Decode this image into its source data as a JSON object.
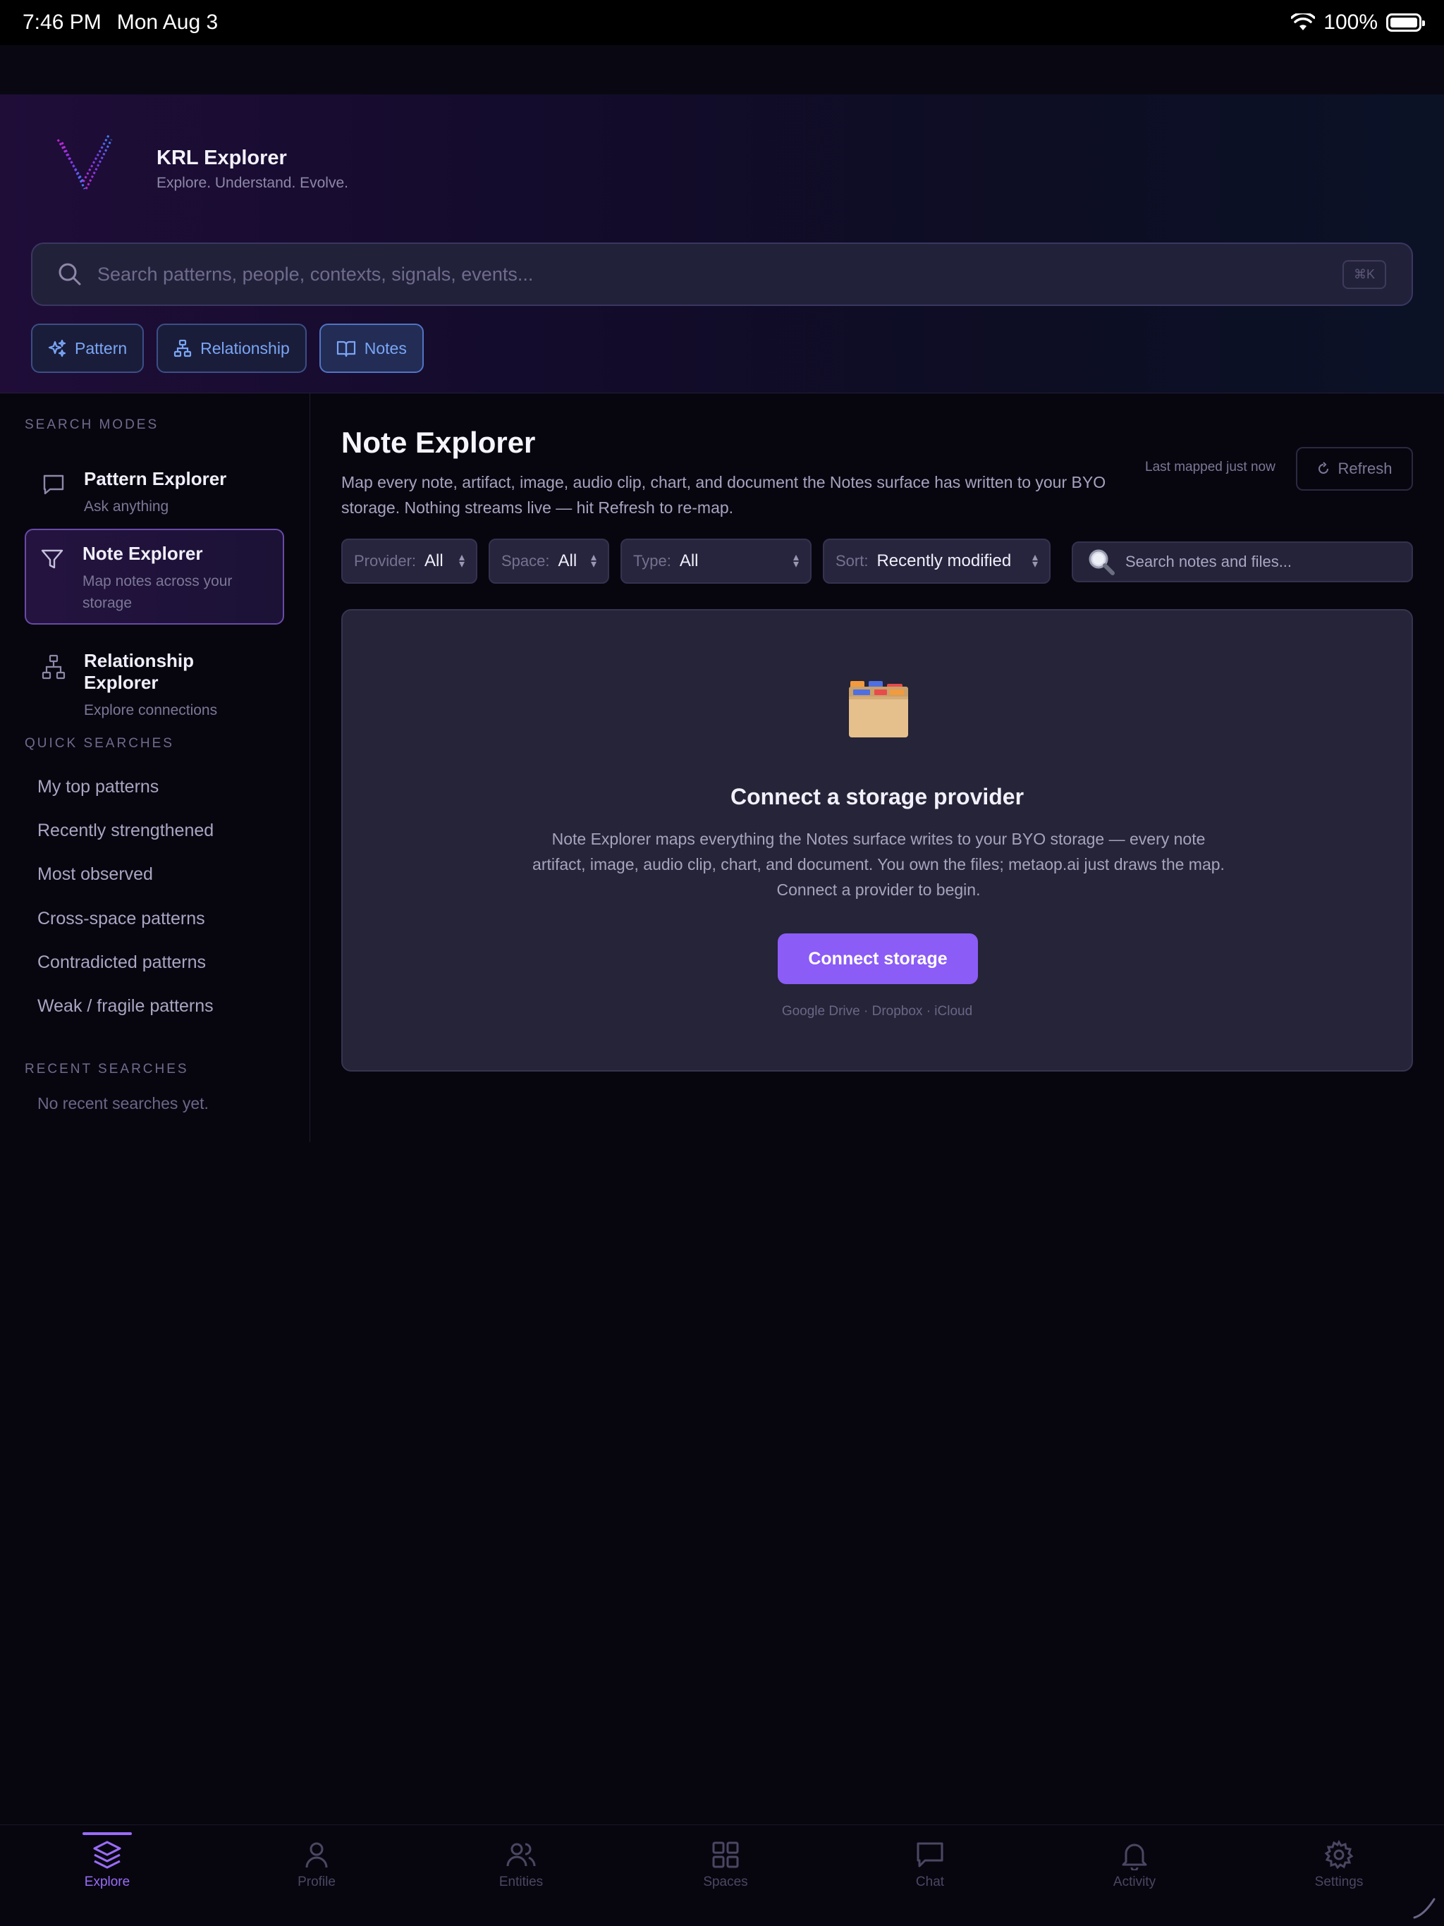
{
  "status_bar": {
    "time": "7:46 PM",
    "date": "Mon Aug 3",
    "battery": "100%"
  },
  "header": {
    "app_title": "KRL Explorer",
    "tagline": "Explore. Understand. Evolve.",
    "search_placeholder": "Search patterns, people, contexts, signals, events...",
    "shortcut": "⌘K",
    "chips": [
      {
        "label": "Pattern",
        "icon": "sparkles-icon"
      },
      {
        "label": "Relationship",
        "icon": "hierarchy-icon"
      },
      {
        "label": "Notes",
        "icon": "book-icon",
        "active": true
      }
    ]
  },
  "sidebar": {
    "search_modes_title": "SEARCH MODES",
    "modes": [
      {
        "title": "Pattern Explorer",
        "subtitle": "Ask anything",
        "icon": "chat-icon"
      },
      {
        "title": "Note Explorer",
        "subtitle": "Map notes across your storage",
        "icon": "filter-icon",
        "active": true
      },
      {
        "title": "Relationship Explorer",
        "subtitle": "Explore connections",
        "icon": "hierarchy-icon"
      }
    ],
    "quick_searches_title": "QUICK SEARCHES",
    "quick_searches": [
      "My top patterns",
      "Recently strengthened",
      "Most observed",
      "Cross-space patterns",
      "Contradicted patterns",
      "Weak / fragile patterns"
    ],
    "recent_searches_title": "RECENT SEARCHES",
    "recent_empty": "No recent searches yet."
  },
  "main": {
    "title": "Note Explorer",
    "description": "Map every note, artifact, image, audio clip, chart, and document the Notes surface has written to your BYO storage. Nothing streams live — hit Refresh to re-map.",
    "last_mapped": "Last mapped just now",
    "refresh_label": "Refresh",
    "filters": {
      "provider": {
        "label": "Provider:",
        "value": "All"
      },
      "space": {
        "label": "Space:",
        "value": "All"
      },
      "type": {
        "label": "Type:",
        "value": "All"
      },
      "sort": {
        "label": "Sort:",
        "value": "Recently modified"
      }
    },
    "notes_search_placeholder": "Search notes and files...",
    "empty_state": {
      "icon": "card-file-box-icon",
      "title": "Connect a storage provider",
      "description": "Note Explorer maps everything the Notes surface writes to your BYO storage — every note artifact, image, audio clip, chart, and document. You own the files; metaop.ai just draws the map. Connect a provider to begin.",
      "button": "Connect storage",
      "providers": "Google Drive · Dropbox · iCloud"
    }
  },
  "tabbar": {
    "tabs": [
      {
        "label": "Explore",
        "icon": "layers-icon",
        "active": true
      },
      {
        "label": "Profile",
        "icon": "user-icon"
      },
      {
        "label": "Entities",
        "icon": "users-icon"
      },
      {
        "label": "Spaces",
        "icon": "grid-icon"
      },
      {
        "label": "Chat",
        "icon": "chat-icon"
      },
      {
        "label": "Activity",
        "icon": "bell-icon"
      },
      {
        "label": "Settings",
        "icon": "gear-icon"
      }
    ]
  },
  "colors": {
    "accent": "#8b5cf6",
    "chip_text": "#7aa6f5",
    "background": "#07060f"
  }
}
